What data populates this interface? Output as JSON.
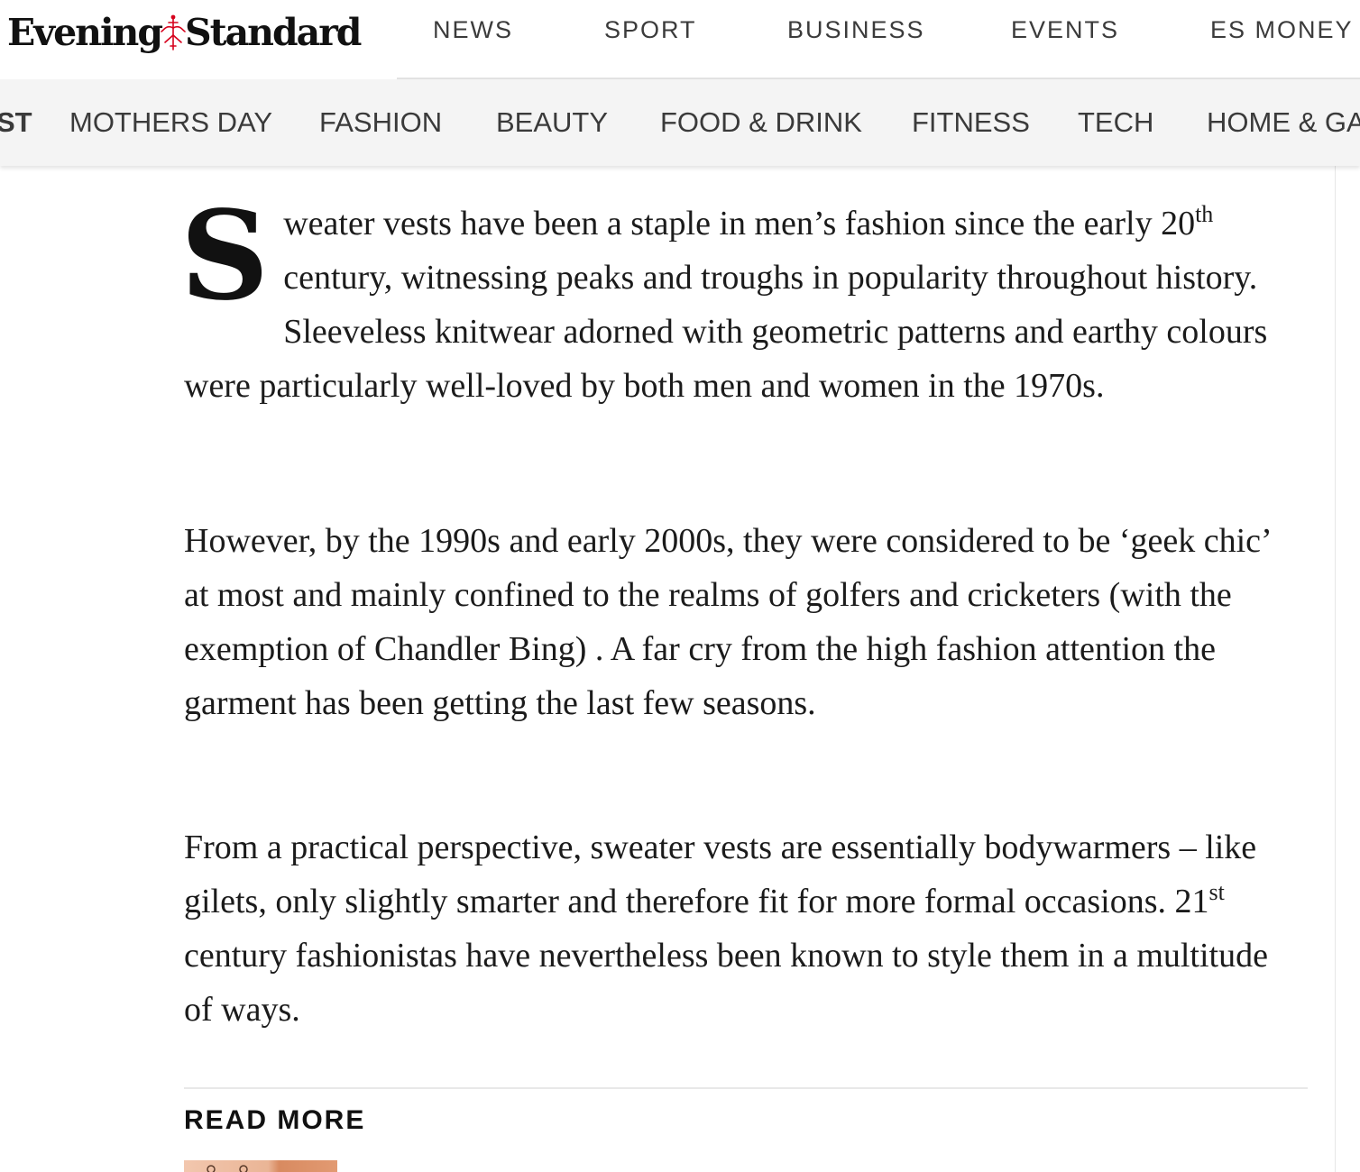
{
  "brand": {
    "logo_left": "Evening",
    "logo_right": "Standard",
    "accent_color": "#d6001c"
  },
  "top_nav": {
    "items": [
      "NEWS",
      "SPORT",
      "BUSINESS",
      "EVENTS",
      "ES MONEY"
    ]
  },
  "sub_nav": {
    "items": [
      "ST",
      "MOTHERS DAY",
      "FASHION",
      "BEAUTY",
      "FOOD & DRINK",
      "FITNESS",
      "TECH",
      "HOME & GA"
    ]
  },
  "article": {
    "paragraphs": [
      {
        "dropcap": "S",
        "before_sup": "weater vests have been a staple in men’s fashion since the early 20",
        "sup": "th",
        "after_sup": " century, witnessing peaks and troughs in popularity throughout history. Sleeveless knitwear adorned with geometric patterns and earthy colours were particularly well-loved by both men and women in the 1970s."
      },
      {
        "text": "However, by the 1990s and early 2000s, they were considered to be ‘geek chic’ at most and mainly confined to the realms of golfers and cricketers (with the exemption of Chandler Bing) . A far cry from the high fashion attention the garment has been getting the last few seasons."
      },
      {
        "before_sup": "From a practical perspective, sweater vests are essentially bodywarmers – like gilets, only slightly smarter and therefore fit for more formal occasions. 21",
        "sup": "st",
        "after_sup": " century fashionistas have nevertheless been known to style them in a multitude of ways."
      }
    ]
  },
  "read_more": {
    "label": "READ MORE"
  }
}
